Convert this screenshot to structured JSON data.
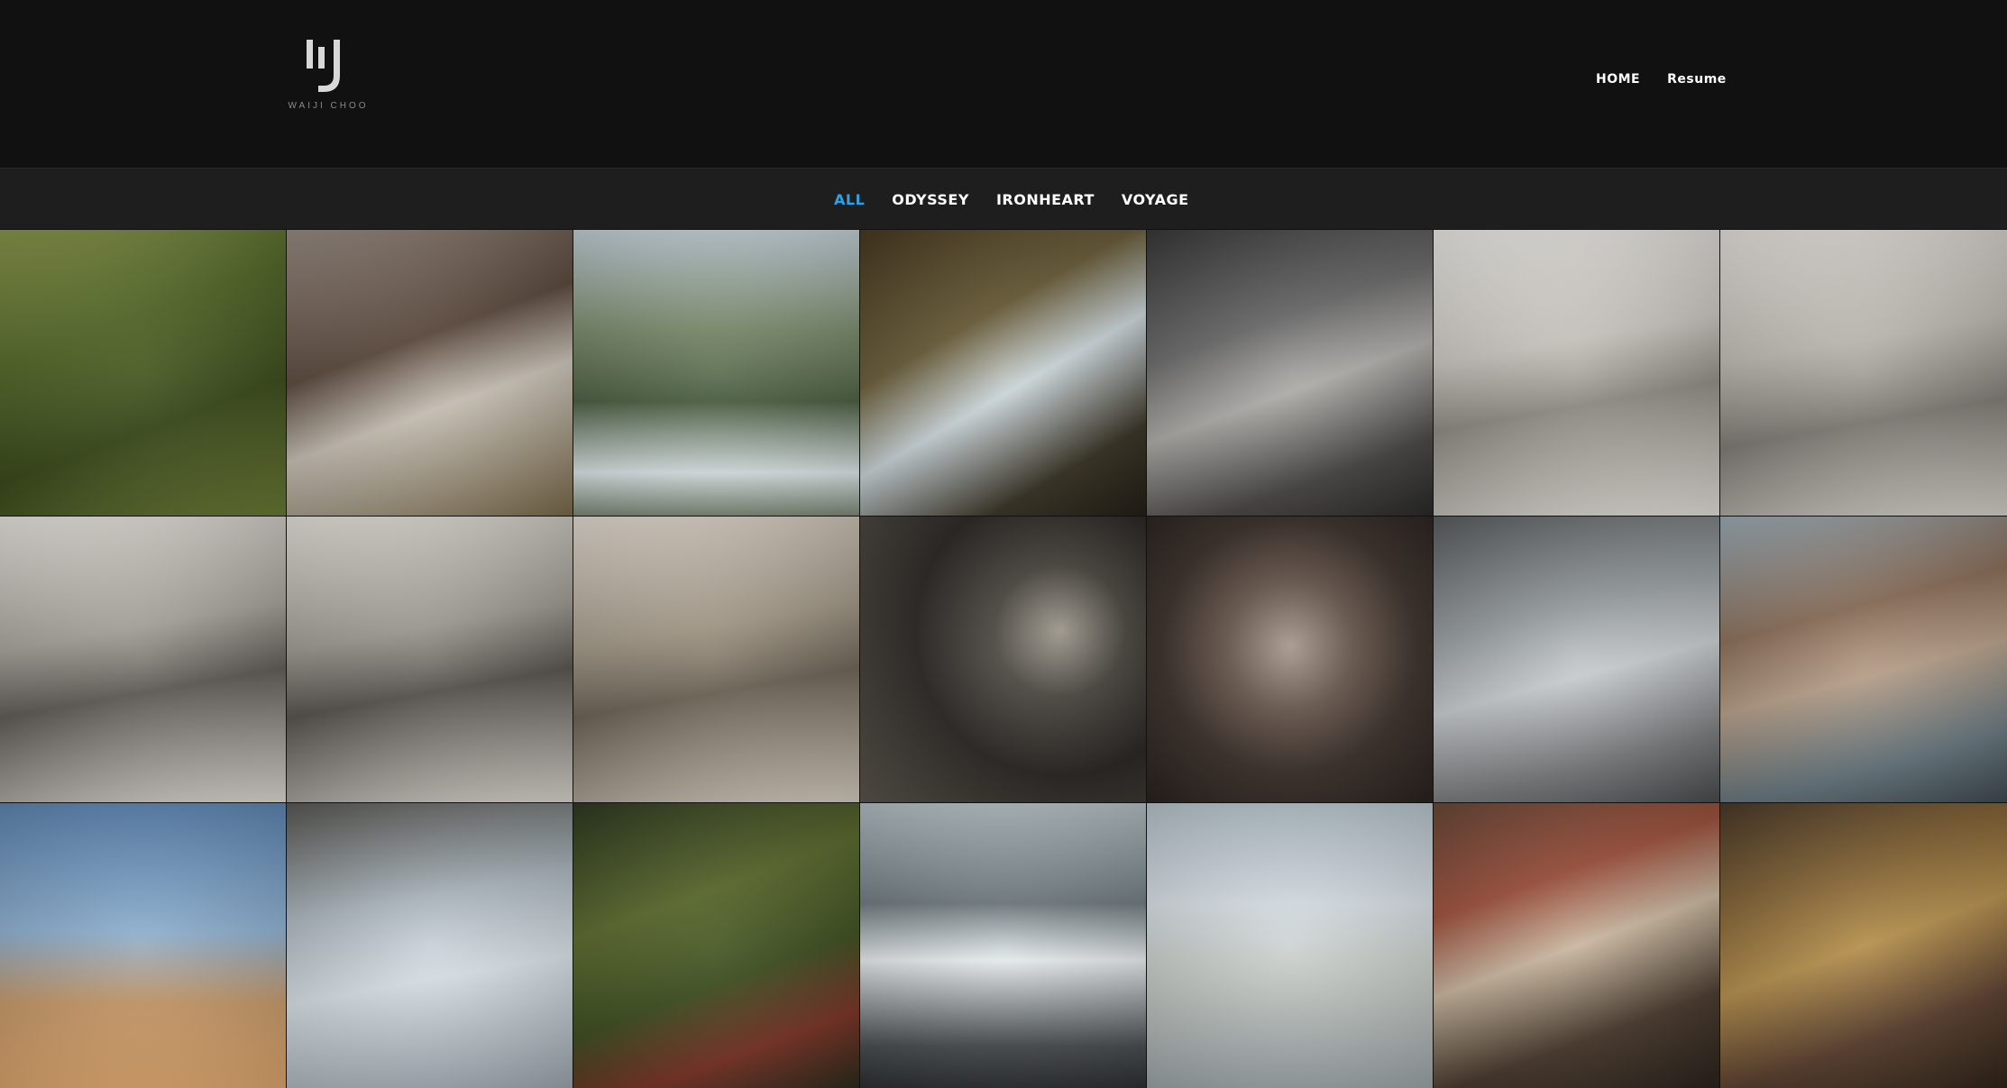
{
  "logo": {
    "text": "WAIJI CHOO"
  },
  "top_nav": [
    {
      "label": "HOME"
    },
    {
      "label": "Resume"
    }
  ],
  "filters": [
    {
      "label": "ALL",
      "active": true
    },
    {
      "label": "ODYSSEY",
      "active": false
    },
    {
      "label": "IRONHEART",
      "active": false
    },
    {
      "label": "VOYAGE",
      "active": false
    }
  ],
  "colors": {
    "background": "#111111",
    "filter_bar": "#1e1e1e",
    "accent": "#2aa3ea",
    "text": "#ffffff"
  },
  "gallery": [
    {
      "bg": "linear-gradient(160deg,#8c9a4e 0%,#55692a 35%,#3b4a1c 65%,#6b7b34 100%)"
    },
    {
      "bg": "linear-gradient(160deg,#9b8f86 0%,#5c4a3e 40%,#c9c3b8 60%,#7a6a4a 100%)"
    },
    {
      "bg": "linear-gradient(180deg,#c6d3db 0%,#7b8b6d 35%,#4b5e42 60%,#dfe8ea 85%,#7e8a78 100%)"
    },
    {
      "bg": "linear-gradient(150deg,#4a3a22 0%,#6b5e3a 35%,#cdd8dc 55%,#3a3426 80%,#251f16 100%)"
    },
    {
      "bg": "linear-gradient(160deg,#3a3a3a 0%,#6d6d6d 35%,#b0aeaa 55%,#4a4846 80%,#2a2a2a 100%)"
    },
    {
      "bg": "linear-gradient(170deg,#f1efea 0%,#c9c6c0 40%,#8f8b84 60%,#e6e3dd 100%)"
    },
    {
      "bg": "linear-gradient(170deg,#ebe8e3 0%,#bdb9b2 40%,#7f7b75 65%,#d9d5ce 100%)"
    },
    {
      "bg": "linear-gradient(170deg,#eeebe5 0%,#a6a29b 40%,#5e5b56 60%,#e2ded8 100%)"
    },
    {
      "bg": "linear-gradient(170deg,#ece9e2 0%,#9e9a93 40%,#56534e 60%,#dedad3 100%)"
    },
    {
      "bg": "linear-gradient(170deg,#e8e0d6 0%,#a29887 40%,#6b6254 60%,#d8d0c4 100%)"
    },
    {
      "bg": "radial-gradient(circle at 70% 40%,#a8a296 0%,#4e4a44 25%,#2a2724 55%,#5d574e 100%)"
    },
    {
      "bg": "radial-gradient(circle at 50% 45%,#a89a90 0%,#6b5a50 30%,#3c322c 60%,#2a2320 100%)"
    },
    {
      "bg": "linear-gradient(165deg,#5c5f62 0%,#9aa0a3 35%,#c9cdcf 55%,#7c7e80 80%,#4a4c4e 100%)"
    },
    {
      "bg": "linear-gradient(165deg,#9fb0bb 0%,#8b6f5a 35%,#b7a08a 55%,#6a7a82 80%,#3f4a50 100%)"
    },
    {
      "bg": "linear-gradient(180deg,#5f87b4 0%,#8fb0cf 45%,#c79a6a 70%,#e0a86e 100%)"
    },
    {
      "bg": "linear-gradient(170deg,#5b5a55 0%,#aeb9c0 35%,#d9e1e6 60%,#9ca7ae 100%)"
    },
    {
      "bg": "linear-gradient(160deg,#2f3a22 0%,#5c6b2f 35%,#3f4f22 60%,#7b3326 80%,#2a2c1c 100%)"
    },
    {
      "bg": "linear-gradient(180deg,#b8c3c8 0%,#6f7a7e 35%,#e6ebee 55%,#4a4f52 85%,#2d3033 100%)"
    },
    {
      "bg": "linear-gradient(180deg,#b9c6cf 0%,#d8dfe4 35%,#c7ccc6 60%,#9ea6a9 100%)"
    },
    {
      "bg": "linear-gradient(160deg,#6b4a3a 0%,#a0533f 30%,#c9b7a0 50%,#4a3b2e 75%,#2a221c 100%)"
    },
    {
      "bg": "linear-gradient(160deg,#4a3a2a 0%,#8a6a3a 30%,#b5904e 50%,#5a4030 75%,#2f2418 100%)"
    }
  ]
}
